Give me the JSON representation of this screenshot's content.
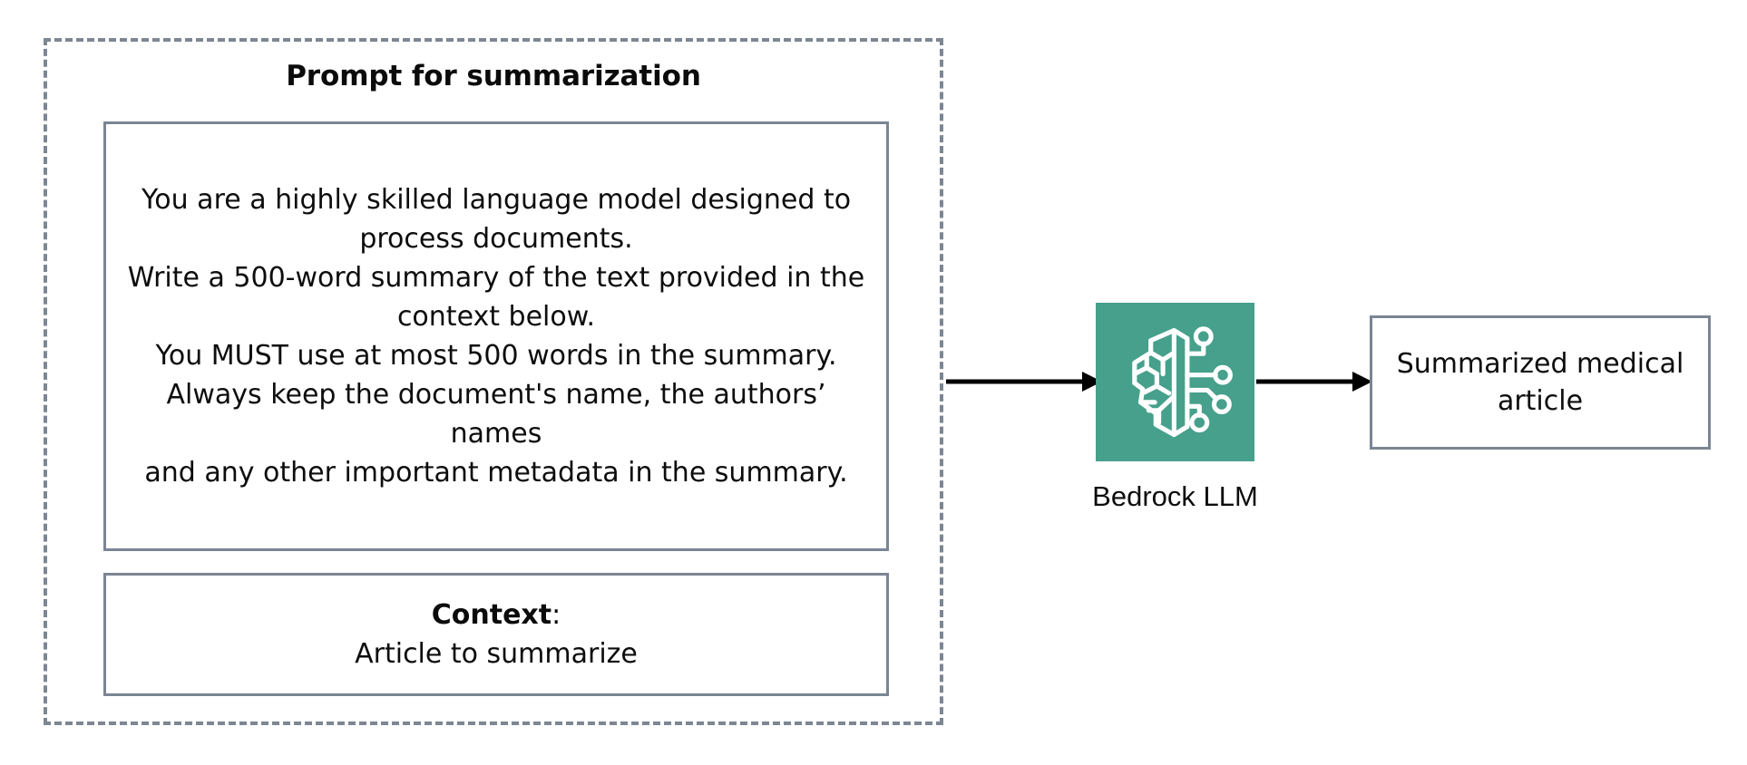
{
  "diagram": {
    "title": "Prompt for summarization",
    "prompt_panel": {
      "title": "Prompt for summarization",
      "instructions_box": {
        "name": "instructions",
        "lines": [
          "You are a highly skilled language model designed to process documents.",
          "Write a 500-word summary of the text provided in the context below.",
          "You MUST use at most 500 words in the summary.",
          "Always keep the document's name, the authors’ names",
          "and any other important metadata in the summary."
        ]
      },
      "context_box": {
        "label": "Context",
        "label_colon": ":",
        "value": "Article to summarize"
      }
    },
    "model_node": {
      "label": "Bedrock LLM",
      "icon": "brain-circuit-icon",
      "tile_color": "#46a08b",
      "icon_color": "#ffffff"
    },
    "output_node": {
      "label": "Summarized medical article"
    },
    "arrows": [
      {
        "name": "arrow-prompt-to-model",
        "from": "prompt_panel",
        "to": "model_node"
      },
      {
        "name": "arrow-model-to-output",
        "from": "model_node",
        "to": "output_node"
      }
    ],
    "colors": {
      "dashed_border": "#7d8793",
      "box_border": "#7b8593",
      "accent_teal": "#46a08b",
      "text": "#0d0d0d",
      "background": "#ffffff",
      "arrow": "#000000"
    }
  }
}
